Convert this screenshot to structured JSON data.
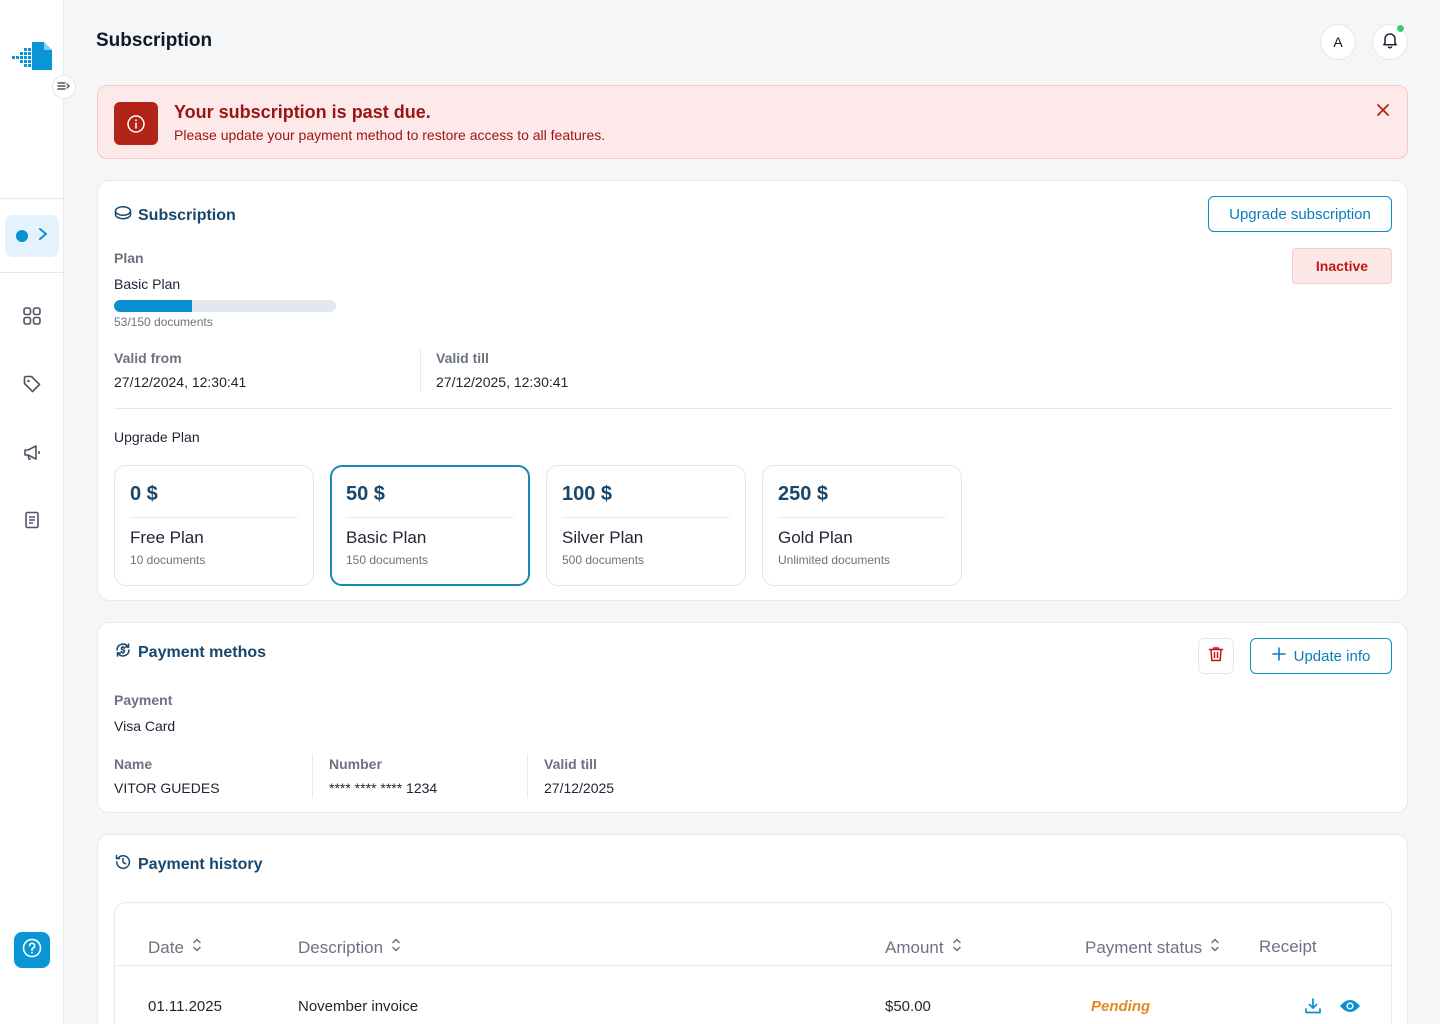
{
  "header": {
    "title": "Subscription",
    "avatar_initial": "A"
  },
  "alert": {
    "title": "Your subscription is past due.",
    "message": "Please update your payment method to restore access to all features."
  },
  "subscription": {
    "heading": "Subscription",
    "upgrade_button": "Upgrade subscription",
    "status": "Inactive",
    "plan_label": "Plan",
    "plan_value": "Basic Plan",
    "usage_text": "53/150 documents",
    "usage_fraction": 0.353,
    "valid_from_label": "Valid from",
    "valid_from": "27/12/2024, 12:30:41",
    "valid_till_label": "Valid till",
    "valid_till": "27/12/2025, 12:30:41",
    "upgrade_plan_label": "Upgrade Plan",
    "plans": [
      {
        "price": "0 $",
        "name": "Free Plan",
        "docs": "10 documents"
      },
      {
        "price": "50 $",
        "name": "Basic Plan",
        "docs": "150 documents"
      },
      {
        "price": "100 $",
        "name": "Silver Plan",
        "docs": "500 documents"
      },
      {
        "price": "250 $",
        "name": "Gold Plan",
        "docs": "Unlimited documents"
      }
    ]
  },
  "payment_method": {
    "heading": "Payment methos",
    "update_button": "Update info",
    "payment_label": "Payment",
    "payment_value": "Visa Card",
    "name_label": "Name",
    "name_value": "VITOR GUEDES",
    "number_label": "Number",
    "number_value": "**** **** **** 1234",
    "valid_till_label": "Valid till",
    "valid_till_value": "27/12/2025"
  },
  "payment_history": {
    "heading": "Payment history",
    "columns": {
      "date": "Date",
      "description": "Description",
      "amount": "Amount",
      "status": "Payment status",
      "receipt": "Receipt"
    },
    "rows": [
      {
        "date": "01.11.2025",
        "description": "November invoice",
        "amount": "$50.00",
        "status": "Pending"
      }
    ]
  },
  "colors": {
    "accent": "#0a8fd0",
    "danger": "#b42318",
    "pending": "#e08a25",
    "heading": "#16476e"
  }
}
